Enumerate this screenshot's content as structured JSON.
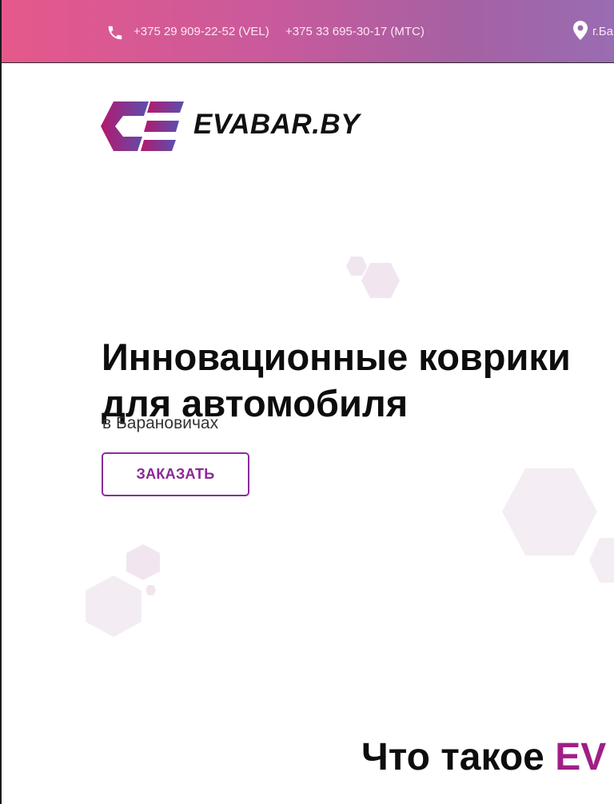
{
  "topbar": {
    "phone_1": "+375 29 909-22-52 (VEL)",
    "phone_2": "+375 33 695-30-17 (МТС)",
    "city": "г.Ба"
  },
  "header": {
    "brand": "EVABAR.BY"
  },
  "hero": {
    "title_line_1": "Инновационные коврики",
    "title_line_2": "для автомобиля",
    "subtitle": "в Барановичах",
    "order_button": "ЗАКАЗАТЬ"
  },
  "section": {
    "title_prefix": "Что такое ",
    "title_accent": "EV"
  },
  "colors": {
    "topbar_gradient_start": "#e6588b",
    "topbar_gradient_end": "#9a6cb2",
    "accent_purple": "#a01f86",
    "button_border": "#8a2c9b"
  },
  "icons": {
    "phone": "phone-icon",
    "location": "map-pin-icon",
    "logo": "evabar-logo-icon"
  }
}
